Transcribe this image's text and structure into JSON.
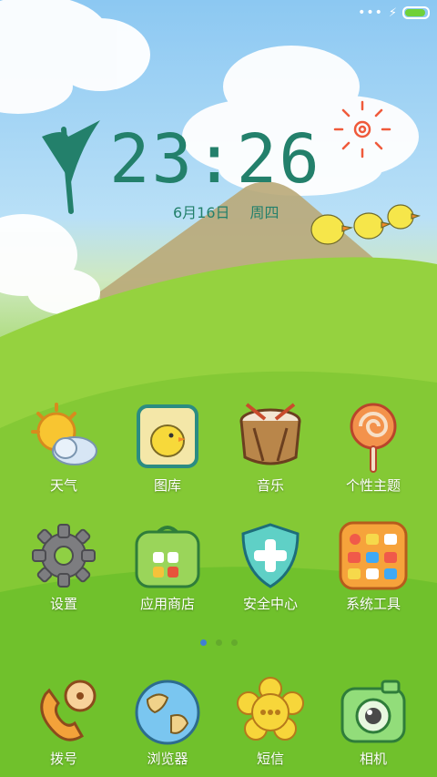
{
  "status_bar": {
    "signal_dots": "•••",
    "charging_icon": "bolt-icon",
    "battery_level": 1.0
  },
  "clock": {
    "time": "23:26",
    "date": "6月16日",
    "weekday": "周四"
  },
  "apps": [
    {
      "label": "天气",
      "icon": "weather-icon"
    },
    {
      "label": "图库",
      "icon": "gallery-icon"
    },
    {
      "label": "音乐",
      "icon": "drum-icon"
    },
    {
      "label": "个性主题",
      "icon": "lollipop-icon"
    },
    {
      "label": "设置",
      "icon": "gear-icon"
    },
    {
      "label": "应用商店",
      "icon": "store-bag-icon"
    },
    {
      "label": "安全中心",
      "icon": "shield-plus-icon"
    },
    {
      "label": "系统工具",
      "icon": "tools-folder-icon"
    }
  ],
  "page_indicator": {
    "count": 3,
    "active_index": 0
  },
  "dock": [
    {
      "label": "拨号",
      "icon": "phone-icon"
    },
    {
      "label": "浏览器",
      "icon": "globe-icon"
    },
    {
      "label": "短信",
      "icon": "message-flower-icon"
    },
    {
      "label": "相机",
      "icon": "camera-icon"
    }
  ],
  "colors": {
    "clock_text": "#23806b",
    "sky": "#8cc8f2",
    "grass": "#7cc832",
    "active_dot": "#3f7fd6"
  }
}
